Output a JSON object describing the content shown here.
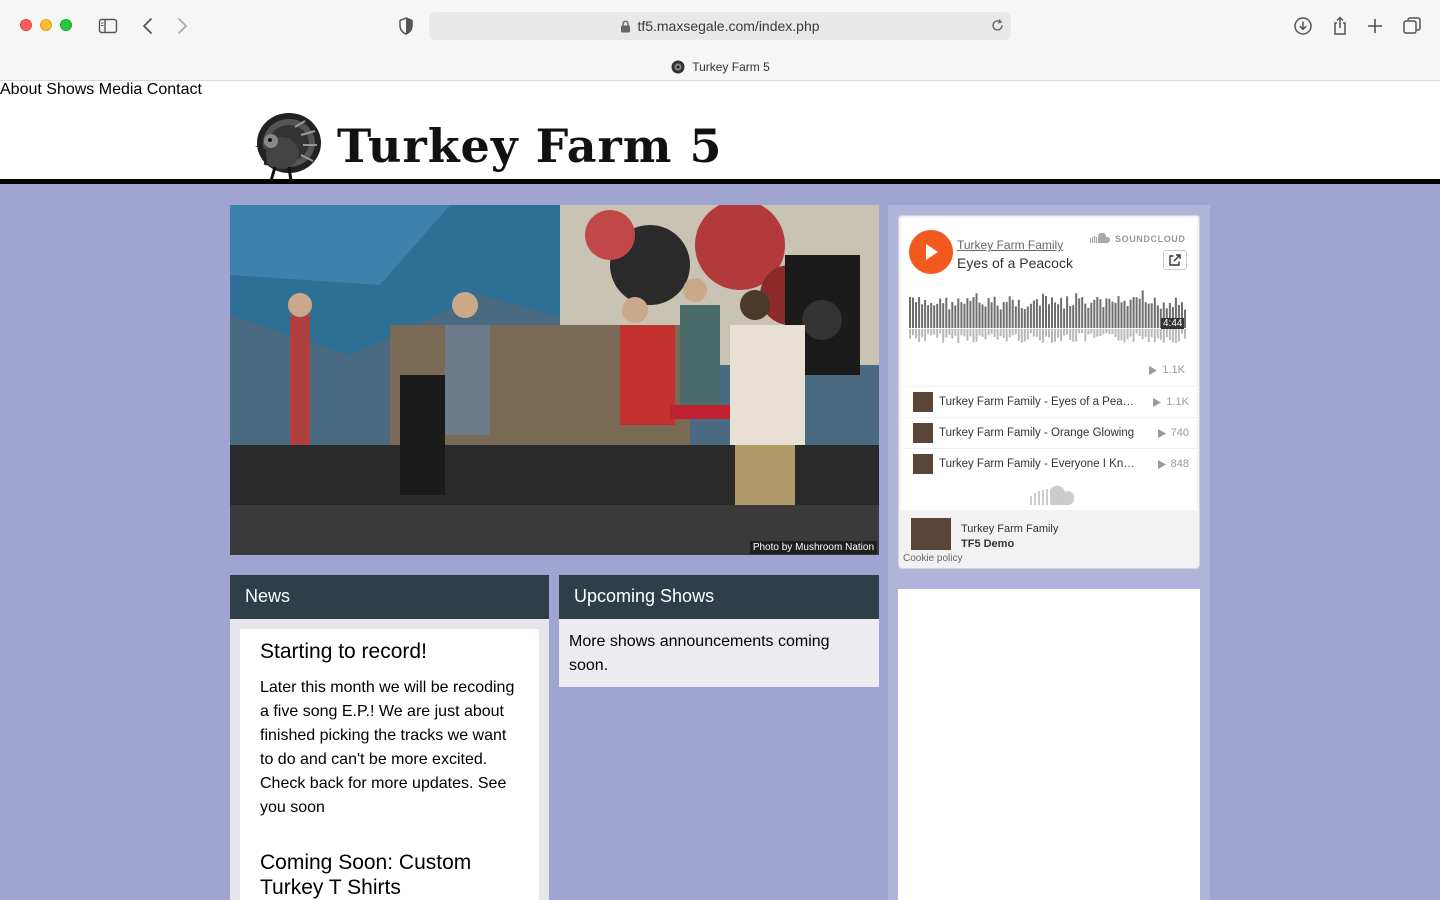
{
  "browser": {
    "url": "tf5.maxsegale.com/index.php",
    "tab_title": "Turkey Farm 5"
  },
  "site": {
    "logo_text": "Turkey Farm 5",
    "nav": [
      {
        "label": "About"
      },
      {
        "label": "Shows"
      },
      {
        "label": "Media"
      },
      {
        "label": "Contact"
      }
    ]
  },
  "hero": {
    "credit": "Photo by Mushroom Nation"
  },
  "news": {
    "heading": "News",
    "posts": [
      {
        "title": "Starting to record!",
        "body": "Later this month we will be recoding a five song E.P.! We are just about finished picking the tracks we want to do and can't be more excited. Check back for more updates. See you soon"
      },
      {
        "title": "Coming Soon: Custom Turkey T Shirts",
        "body": ""
      }
    ]
  },
  "shows": {
    "heading": "Upcoming Shows",
    "body": "More shows announcements coming soon."
  },
  "soundcloud": {
    "artist": "Turkey Farm Family",
    "track": "Eyes of a Peacock",
    "brand": "SOUNDCLOUD",
    "duration": "4:44",
    "plays": "1.1K",
    "tracks": [
      {
        "name": "Turkey Farm Family - Eyes of a Peacock",
        "plays": "1.1K"
      },
      {
        "name": "Turkey Farm Family - Orange Glowing",
        "plays": "740"
      },
      {
        "name": "Turkey Farm Family - Everyone I Know",
        "plays": "848"
      }
    ],
    "footer_artist": "Turkey Farm Family",
    "footer_playlist": "TF5 Demo",
    "cookie": "Cookie policy"
  },
  "colors": {
    "page_bg": "#9fa4d0",
    "panel_header": "#2f3f49",
    "soundcloud_orange": "#f2591f"
  }
}
